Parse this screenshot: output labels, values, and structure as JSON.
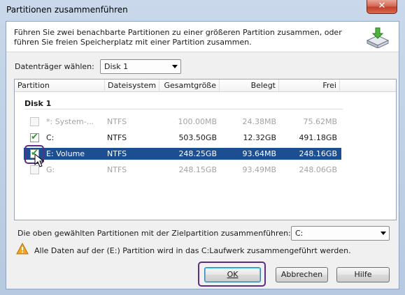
{
  "window": {
    "title": "Partitionen zusammenführen",
    "close_label": "✕"
  },
  "header": {
    "description": "Führen Sie zwei benachbarte Partitionen zu einer größeren Partition zusammen, oder führen Sie freien Speicherplatz mit einer Partition zusammen.",
    "icon": "merge-disk-icon"
  },
  "disk_select": {
    "label": "Datenträger wählen:",
    "value": "Disk 1"
  },
  "table": {
    "columns": [
      "Partition",
      "Dateisystem",
      "Gesamtgröße",
      "Belegt",
      "Frei"
    ],
    "group": "Disk 1",
    "rows": [
      {
        "name": "*: System-...",
        "fs": "NTFS",
        "total": "100.00MB",
        "used": "24.38MB",
        "free": "75.62MB",
        "checked": false,
        "enabled": false,
        "selected": false
      },
      {
        "name": "C:",
        "fs": "NTFS",
        "total": "503.50GB",
        "used": "12.32GB",
        "free": "491.18GB",
        "checked": true,
        "enabled": true,
        "selected": false
      },
      {
        "name": "E:  Volume",
        "fs": "NTFS",
        "total": "248.25GB",
        "used": "93.64MB",
        "free": "248.16GB",
        "checked": true,
        "enabled": true,
        "selected": true
      },
      {
        "name": "G:",
        "fs": "NTFS",
        "total": "248.15GB",
        "used": "93.49MB",
        "free": "248.06GB",
        "checked": false,
        "enabled": false,
        "selected": false
      }
    ]
  },
  "target": {
    "label": "Die oben gewählten Partitionen mit der Zielpartition zusammenführen:",
    "value": "C:"
  },
  "warning": {
    "text": "Alle Daten auf der (E:) Partition wird in das C:Laufwerk zusammengeführt werden."
  },
  "buttons": {
    "ok": "OK",
    "cancel": "Abbrechen",
    "help": "Hilfe"
  },
  "colors": {
    "selection": "#1c4f91",
    "highlight_outline": "#5a2d86",
    "check": "#2b9a2b"
  }
}
